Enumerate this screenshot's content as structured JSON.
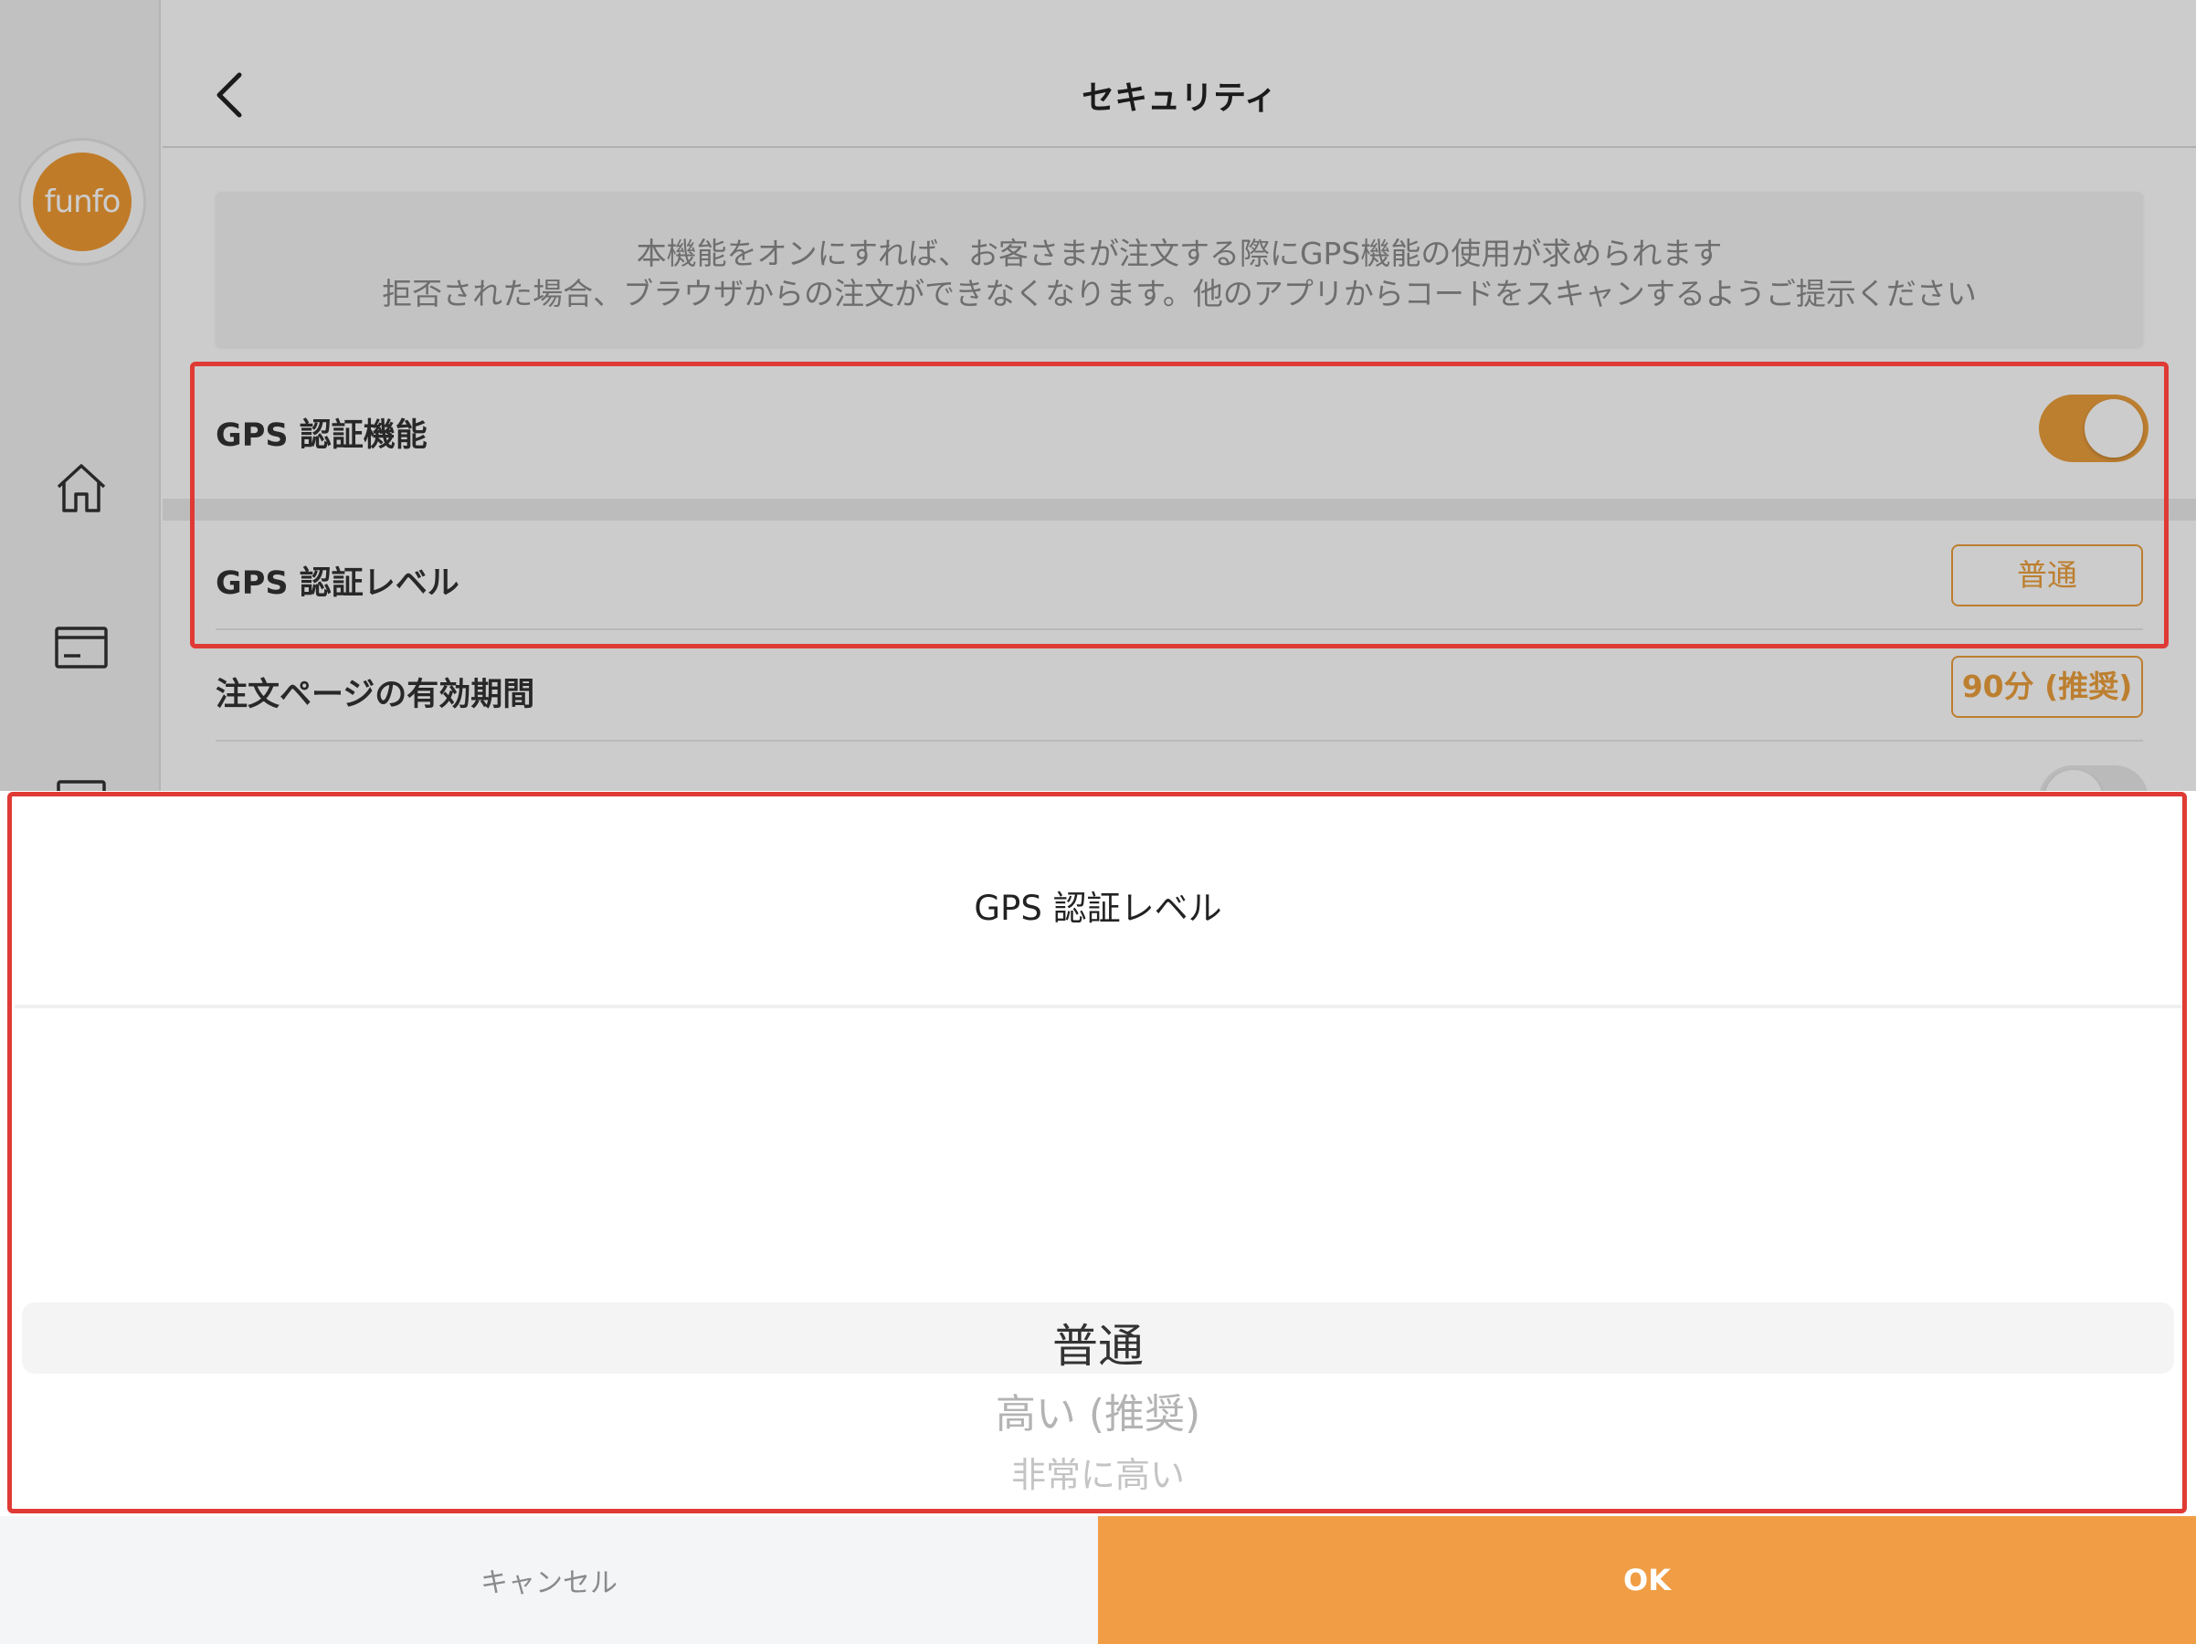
{
  "colors": {
    "accent": "#f09d45",
    "highlight_box": "#e03a35"
  },
  "sidebar": {
    "logo_text": "funfo",
    "icons": [
      "home-icon",
      "card-icon",
      "list-icon"
    ]
  },
  "header": {
    "back_icon": "chevron-left-icon",
    "title": "セキュリティ"
  },
  "notice": {
    "line1": "本機能をオンにすれば、お客さまが注文する際にGPS機能の使用が求められます",
    "line2": "拒否された場合、ブラウザからの注文ができなくなります。他のアプリからコードをスキャンするようご提示ください"
  },
  "settings": {
    "gps_auth": {
      "label": "GPS 認証機能",
      "enabled": true
    },
    "gps_level": {
      "label": "GPS 認証レベル",
      "value": "普通"
    },
    "valid_period": {
      "label": "注文ページの有効期間",
      "value": "90分 (推奨)"
    }
  },
  "sheet": {
    "title": "GPS 認証レベル",
    "options": [
      "普通",
      "高い (推奨)",
      "非常に高い"
    ],
    "selected": "普通",
    "cancel_label": "キャンセル",
    "ok_label": "OK"
  }
}
